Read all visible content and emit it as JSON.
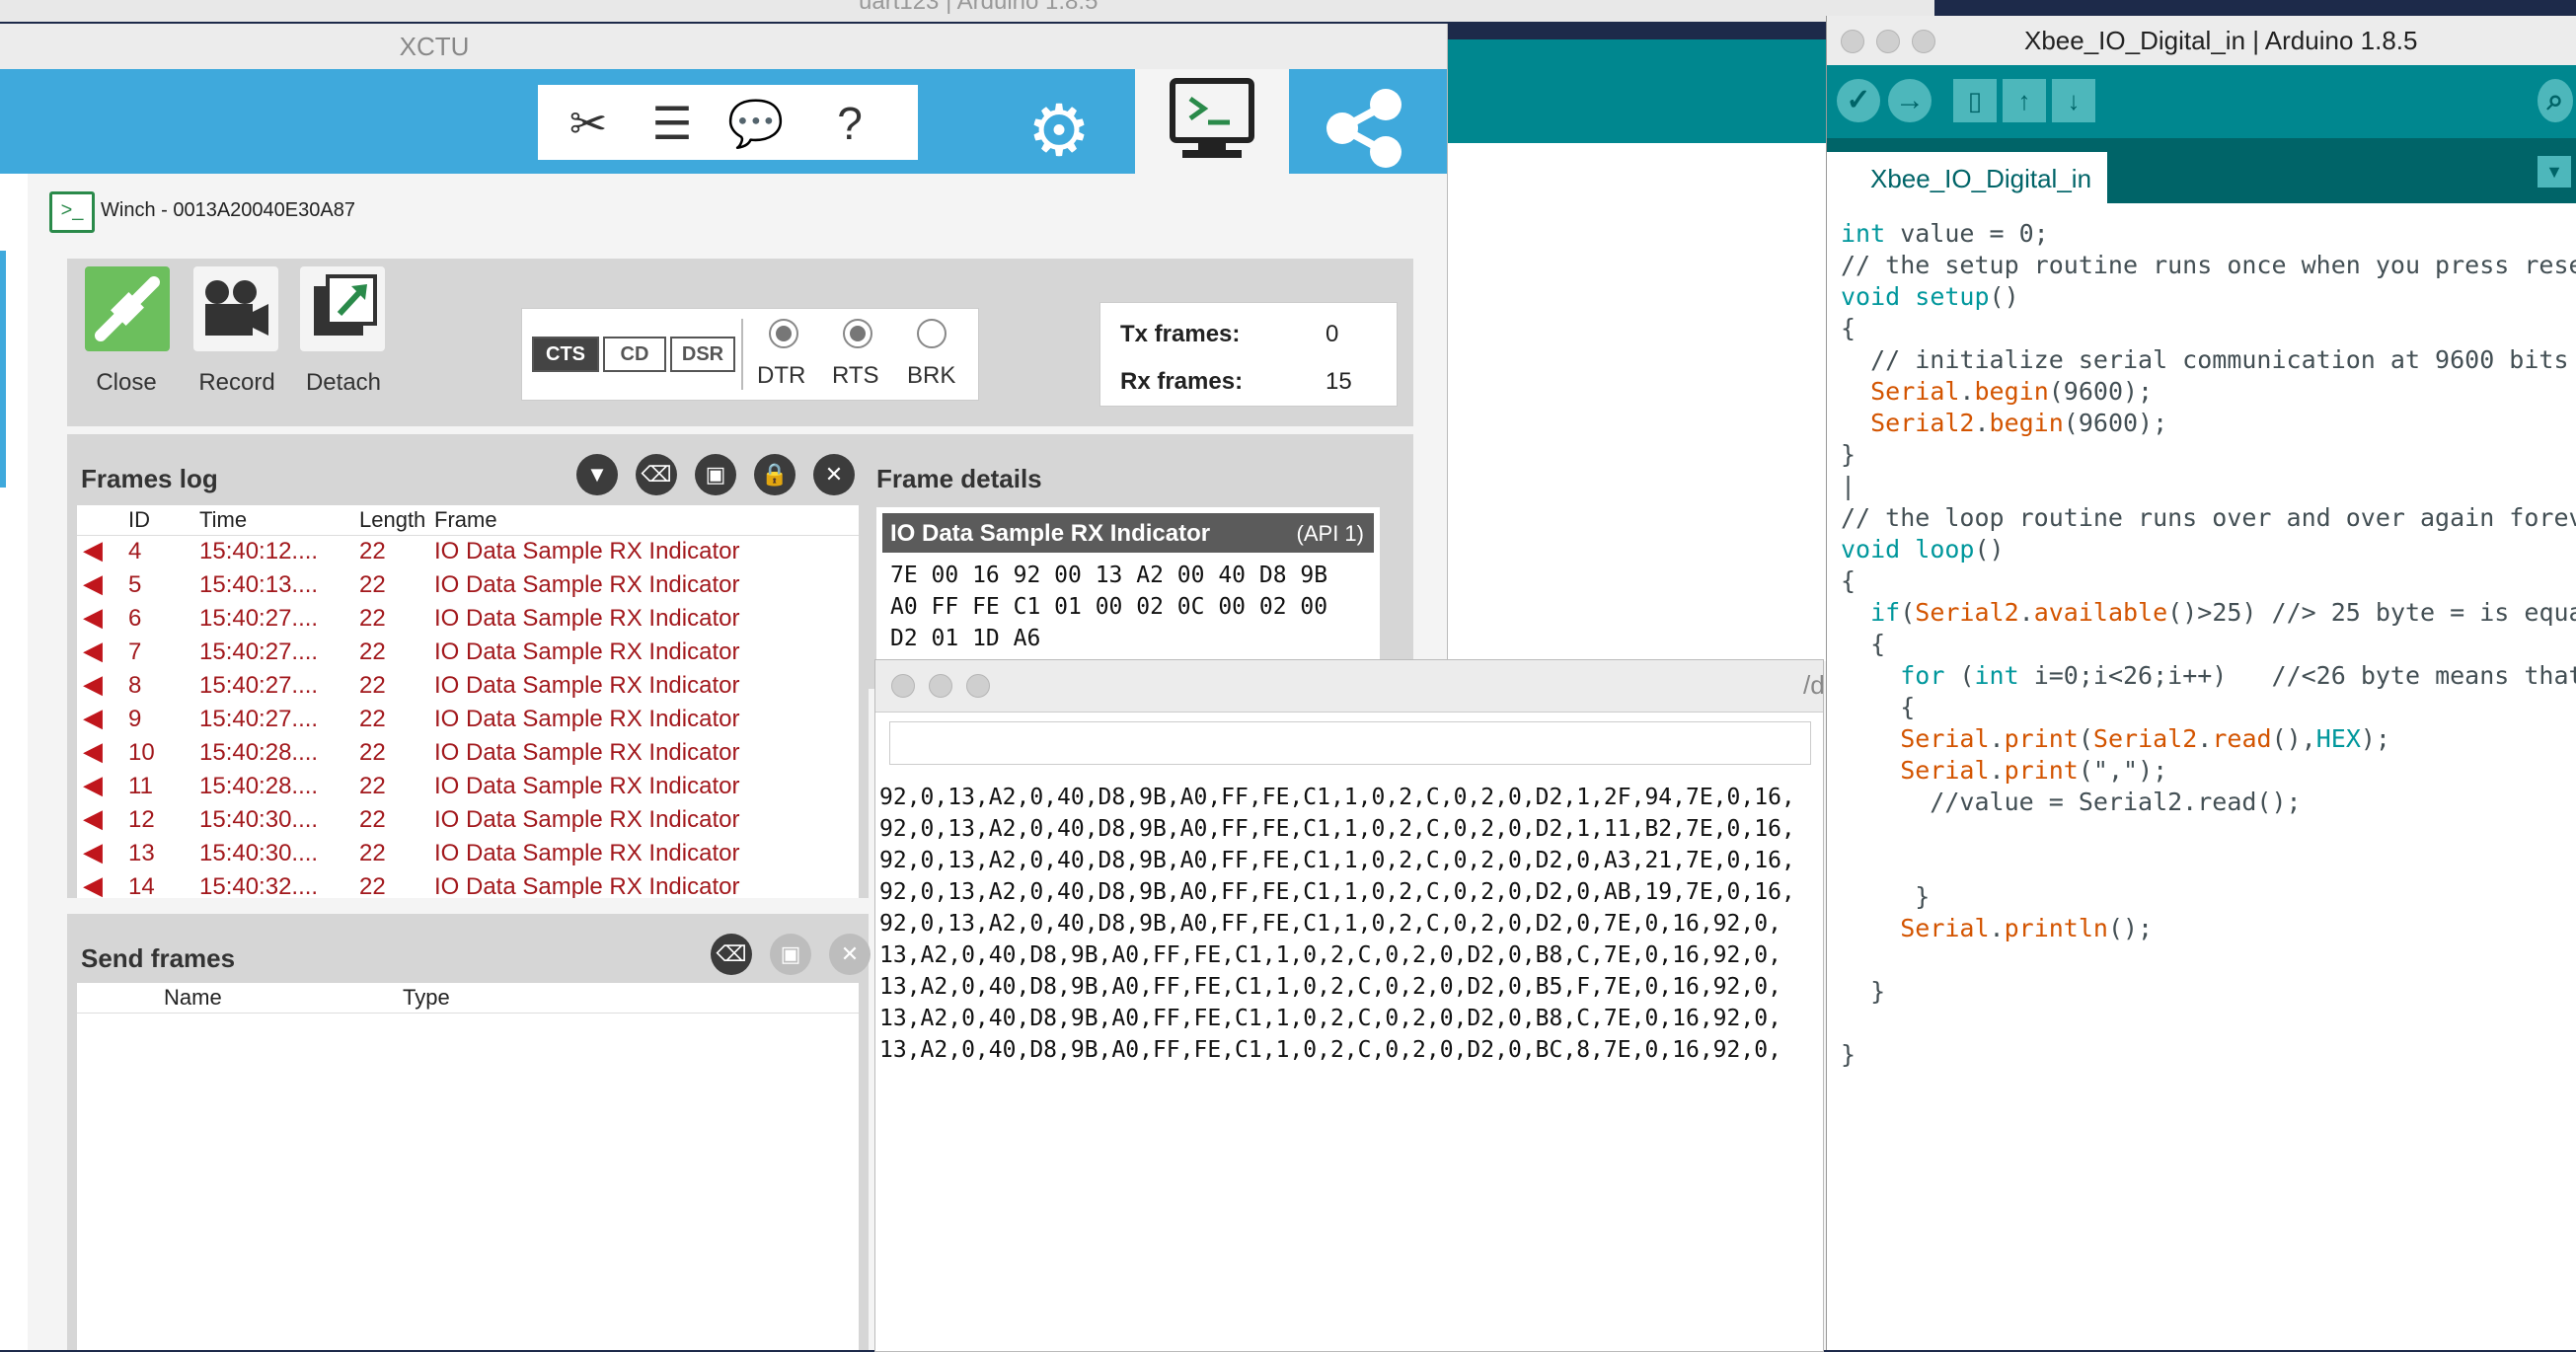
{
  "background": {
    "title": "uart123 | Arduino 1.8.5"
  },
  "xctu": {
    "title": "XCTU",
    "device_name": "Winch - 0013A20040E30A87",
    "connection": {
      "close_label": "Close",
      "record_label": "Record",
      "detach_label": "Detach",
      "cts": "CTS",
      "cd": "CD",
      "dsr": "DSR",
      "dtr": "DTR",
      "rts": "RTS",
      "brk": "BRK",
      "tx_label": "Tx frames:",
      "tx_value": "0",
      "rx_label": "Rx frames:",
      "rx_value": "15"
    },
    "frames_log": {
      "title": "Frames log",
      "columns": [
        "ID",
        "Time",
        "Length",
        "Frame"
      ],
      "rows": [
        {
          "id": "4",
          "time": "15:40:12....",
          "length": "22",
          "frame": "IO Data Sample RX Indicator"
        },
        {
          "id": "5",
          "time": "15:40:13....",
          "length": "22",
          "frame": "IO Data Sample RX Indicator"
        },
        {
          "id": "6",
          "time": "15:40:27....",
          "length": "22",
          "frame": "IO Data Sample RX Indicator"
        },
        {
          "id": "7",
          "time": "15:40:27....",
          "length": "22",
          "frame": "IO Data Sample RX Indicator"
        },
        {
          "id": "8",
          "time": "15:40:27....",
          "length": "22",
          "frame": "IO Data Sample RX Indicator"
        },
        {
          "id": "9",
          "time": "15:40:27....",
          "length": "22",
          "frame": "IO Data Sample RX Indicator"
        },
        {
          "id": "10",
          "time": "15:40:28....",
          "length": "22",
          "frame": "IO Data Sample RX Indicator"
        },
        {
          "id": "11",
          "time": "15:40:28....",
          "length": "22",
          "frame": "IO Data Sample RX Indicator"
        },
        {
          "id": "12",
          "time": "15:40:30....",
          "length": "22",
          "frame": "IO Data Sample RX Indicator"
        },
        {
          "id": "13",
          "time": "15:40:30....",
          "length": "22",
          "frame": "IO Data Sample RX Indicator"
        },
        {
          "id": "14",
          "time": "15:40:32....",
          "length": "22",
          "frame": "IO Data Sample RX Indicator"
        }
      ]
    },
    "frame_details": {
      "title": "Frame details",
      "header_name": "IO Data Sample RX Indicator",
      "header_api": "(API 1)",
      "hex_lines": [
        "7E 00 16 92 00 13 A2 00 40 D8 9B",
        "A0 FF FE C1 01 00 02 0C 00 02 00",
        "D2 01 1D A6"
      ]
    },
    "send_frames": {
      "title": "Send frames",
      "columns": [
        "Name",
        "Type"
      ]
    }
  },
  "serial_monitor": {
    "title_fragment": "/d",
    "lines": [
      "92,0,13,A2,0,40,D8,9B,A0,FF,FE,C1,1,0,2,C,0,2,0,D2,1,2F,94,7E,0,16,",
      "92,0,13,A2,0,40,D8,9B,A0,FF,FE,C1,1,0,2,C,0,2,0,D2,1,11,B2,7E,0,16,",
      "92,0,13,A2,0,40,D8,9B,A0,FF,FE,C1,1,0,2,C,0,2,0,D2,0,A3,21,7E,0,16,",
      "92,0,13,A2,0,40,D8,9B,A0,FF,FE,C1,1,0,2,C,0,2,0,D2,0,AB,19,7E,0,16,",
      "92,0,13,A2,0,40,D8,9B,A0,FF,FE,C1,1,0,2,C,0,2,0,D2,0,7E,0,16,92,0,",
      "13,A2,0,40,D8,9B,A0,FF,FE,C1,1,0,2,C,0,2,0,D2,0,B8,C,7E,0,16,92,0,",
      "13,A2,0,40,D8,9B,A0,FF,FE,C1,1,0,2,C,0,2,0,D2,0,B5,F,7E,0,16,92,0,",
      "13,A2,0,40,D8,9B,A0,FF,FE,C1,1,0,2,C,0,2,0,D2,0,B8,C,7E,0,16,92,0,",
      "13,A2,0,40,D8,9B,A0,FF,FE,C1,1,0,2,C,0,2,0,D2,0,BC,8,7E,0,16,92,0,"
    ]
  },
  "arduino_ide": {
    "title": "Xbee_IO_Digital_in | Arduino 1.8.5",
    "tab_label": "Xbee_IO_Digital_in",
    "colors": {
      "teal": "#00878f",
      "dark_teal": "#006468",
      "keyword": "#00979c",
      "function": "#d35400"
    }
  }
}
